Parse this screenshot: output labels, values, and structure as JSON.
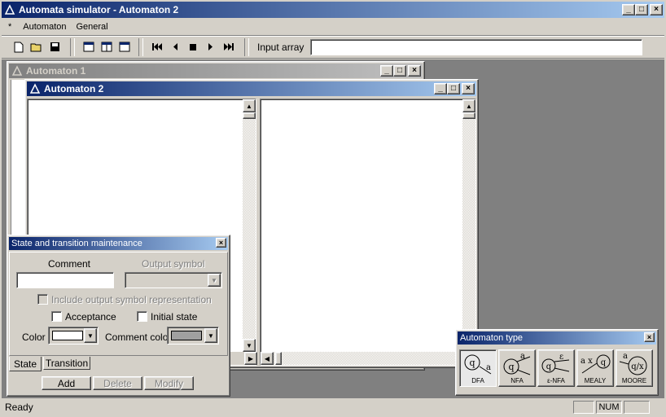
{
  "app": {
    "title": "Automata simulator - Automaton 2",
    "min": "_",
    "max": "□",
    "close": "×"
  },
  "menu": {
    "system": "*",
    "items": [
      "Automaton",
      "General"
    ]
  },
  "toolbar": {
    "input_label": "Input array",
    "input_value": ""
  },
  "win1": {
    "title": "Automaton 1"
  },
  "win2": {
    "title": "Automaton 2"
  },
  "panel": {
    "title": "State and transition maintenance",
    "comment_label": "Comment",
    "comment_value": "",
    "output_label": "Output symbol",
    "include_label": "Include output symbol representation",
    "acceptance_label": "Acceptance",
    "initial_label": "Initial state",
    "color_label": "Color",
    "comment_color_label": "Comment color",
    "color_value": "#ffffff",
    "comment_color_value": "#a0a0a0",
    "tabs": [
      "State",
      "Transition"
    ],
    "buttons": [
      "Add",
      "Delete",
      "Modify"
    ]
  },
  "atype": {
    "title": "Automaton type",
    "types": [
      {
        "name": "DFA",
        "glyph": "q",
        "sym": "a"
      },
      {
        "name": "NFA",
        "glyph": "q",
        "sym": "a"
      },
      {
        "name": "ε-NFA",
        "glyph": "q",
        "sym": "ε"
      },
      {
        "name": "MEALY",
        "glyph": "q",
        "sym": "a x"
      },
      {
        "name": "MOORE",
        "glyph": "q/x",
        "sym": "a"
      }
    ]
  },
  "status": {
    "text": "Ready",
    "num": "NUM"
  }
}
